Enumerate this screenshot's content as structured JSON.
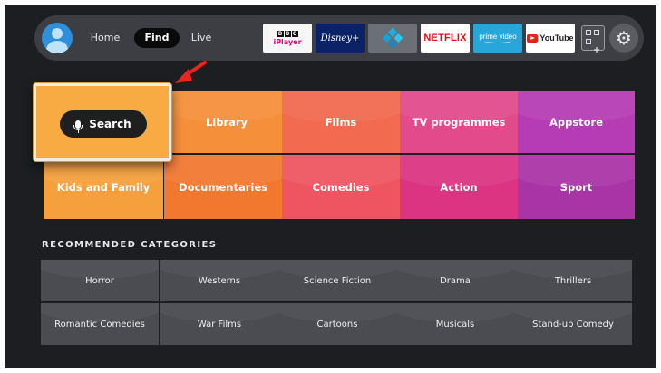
{
  "nav": {
    "tabs": [
      {
        "label": "Home"
      },
      {
        "label": "Find",
        "active": true
      },
      {
        "label": "Live"
      }
    ],
    "apps": {
      "bbc": {
        "top": "BBC",
        "bottom": "iPlayer"
      },
      "disney": "Disney+",
      "kodi": "kodi-icon",
      "netflix": "NETFLIX",
      "prime": "prime video",
      "youtube": "YouTube"
    },
    "icons": [
      "avatar-icon",
      "apps-grid-icon",
      "gear-icon"
    ]
  },
  "search": {
    "label": "Search"
  },
  "categories": [
    {
      "label": "Library",
      "color": "#f58f3a"
    },
    {
      "label": "Films",
      "color": "#f26a4f"
    },
    {
      "label": "TV programmes",
      "color": "#e24a8c"
    },
    {
      "label": "Appstore",
      "color": "#b53cb4"
    },
    {
      "label": "Kids and Family",
      "color": "#f6a03d"
    },
    {
      "label": "Documentaries",
      "color": "#f27830"
    },
    {
      "label": "Comedies",
      "color": "#ef5560"
    },
    {
      "label": "Action",
      "color": "#dc3382"
    },
    {
      "label": "Sport",
      "color": "#a934a6"
    }
  ],
  "recommended": {
    "title": "RECOMMENDED CATEGORIES",
    "items": [
      "Horror",
      "Westerns",
      "Science Fiction",
      "Drama",
      "Thrillers",
      "Romantic Comedies",
      "War Films",
      "Cartoons",
      "Musicals",
      "Stand-up Comedy"
    ]
  },
  "colors": {
    "accent_arrow": "#e8261e",
    "focus_border": "#f1ece2",
    "search_tile": "#f7ab42"
  }
}
